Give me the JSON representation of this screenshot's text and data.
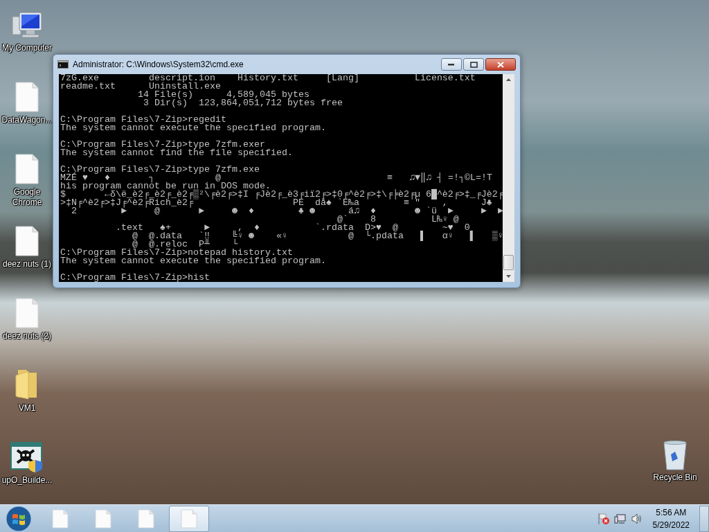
{
  "desktop_icons": [
    {
      "label": "My Computer",
      "kind": "computer"
    },
    {
      "label": "DataWagon...",
      "kind": "document"
    },
    {
      "label": "Google Chrome",
      "kind": "document"
    },
    {
      "label": "deez nuts (1)",
      "kind": "document"
    },
    {
      "label": "deez nuts (2)",
      "kind": "document"
    },
    {
      "label": "VM1",
      "kind": "folder"
    },
    {
      "label": "upO_Builde...",
      "kind": "program"
    }
  ],
  "recycle_bin": {
    "label": "Recycle Bin"
  },
  "window": {
    "title": "Administrator: C:\\Windows\\System32\\cmd.exe",
    "console_blocks": [
      [
        "7zG.exe         descript.ion    History.txt     [Lang]          License.txt",
        "readme.txt      Uninstall.exe",
        "              14 File(s)      4,589,045 bytes",
        "               3 Dir(s)  123,864,051,712 bytes free"
      ],
      [
        "C:\\Program Files\\7-Zip>regedit",
        "The system cannot execute the specified program."
      ],
      [
        "C:\\Program Files\\7-Zip>type 7zfm.exer",
        "The system cannot find the file specified."
      ],
      [
        "C:\\Program Files\\7-Zip>type 7zfm.exe",
        "MZÉ ♥   ♦       ┐           @                              ≡   ♫▼‖♫ ┤ =!┐©L=!T",
        "his program cannot be run in DOS mode.",
        "$       ←δ\\ë_è2╒_è2╒_è2╒▒²\\╒è2╒>‡I ╒Jè2╒_è3╒iï2╒>‡0╒^è2╒>‡\\╒╞è2╒µ 6█^è2╒>‡_╒Jè2╒",
        ">‡N╒^è2╒>‡J╒^è2╒Rich_è2╒                  PE  då♠ `E₧a        ≡ \"    ,      J♣",
        "  2        ►     @       ►     ☻  ♦        ♣ ☻      á♫  ♦       ☻ `ü  ►     ►  ►",
        "                                                  @`    8          L₧♀ @",
        "          .text   ♠+      ►     ,  ♦          `.rdata  D>♥  @        ~♥  0",
        "             @  @.data   `‼    ╚♀ ☻    «♀           @  └.pdata   ▌   α♀   ▌   ▒♀",
        "             @  @.reloc  P╨    └",
        "C:\\Program Files\\7-Zip>notepad history.txt",
        "The system cannot execute the specified program."
      ],
      [
        "C:\\Program Files\\7-Zip>hist"
      ]
    ]
  },
  "taskbar_items": [
    {
      "kind": "document",
      "selected": false
    },
    {
      "kind": "document",
      "selected": false
    },
    {
      "kind": "document",
      "selected": false
    },
    {
      "kind": "document",
      "selected": true
    }
  ],
  "tray": {
    "time": "5:56 AM",
    "date": "5/29/2022"
  }
}
